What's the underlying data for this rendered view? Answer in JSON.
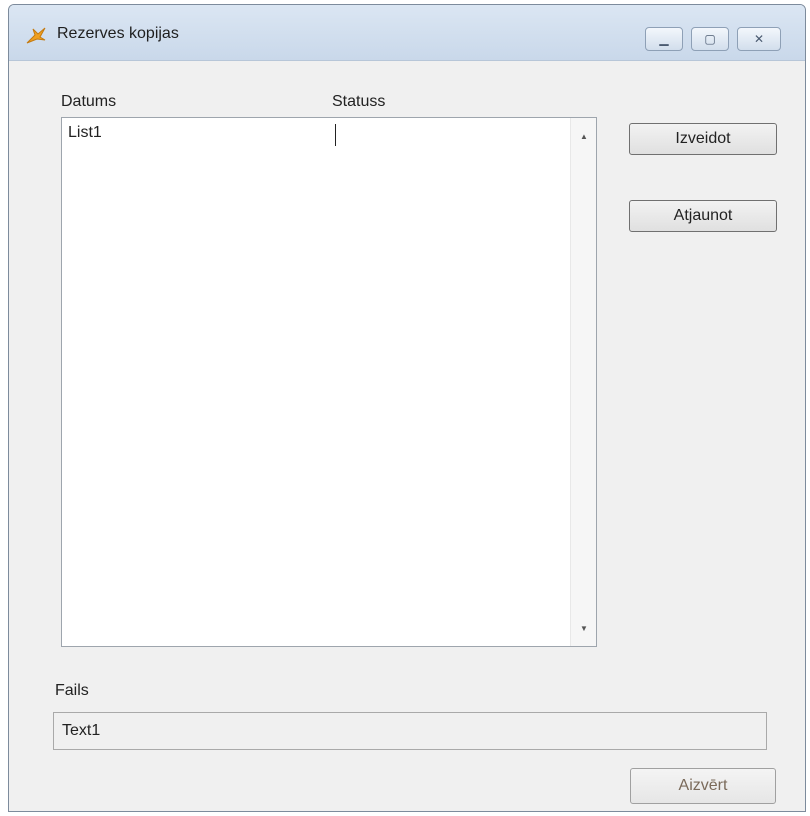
{
  "window": {
    "title": "Rezerves kopijas",
    "icon": "app-icon",
    "controls": {
      "minimize": "minimize-icon",
      "maximize": "maximize-icon",
      "close": "close-icon"
    }
  },
  "list": {
    "columns": [
      "Datums",
      "Statuss"
    ],
    "items": [
      "List1"
    ]
  },
  "buttons": {
    "create": "Izveidot",
    "restore": "Atjaunot",
    "close": "Aizvērt"
  },
  "file": {
    "label": "Fails",
    "value": "Text1"
  },
  "colors": {
    "titlebar": "#c9d8ea",
    "window_bg": "#f0f0f0",
    "disabled_text": "#7a6a5a"
  }
}
